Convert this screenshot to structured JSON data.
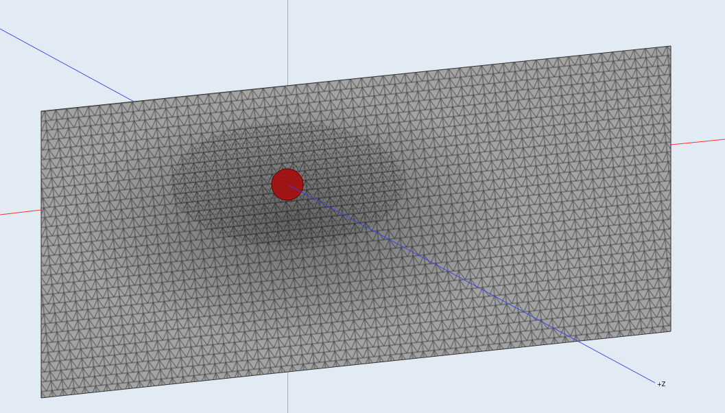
{
  "viewport": {
    "axis_label": "+Z"
  }
}
